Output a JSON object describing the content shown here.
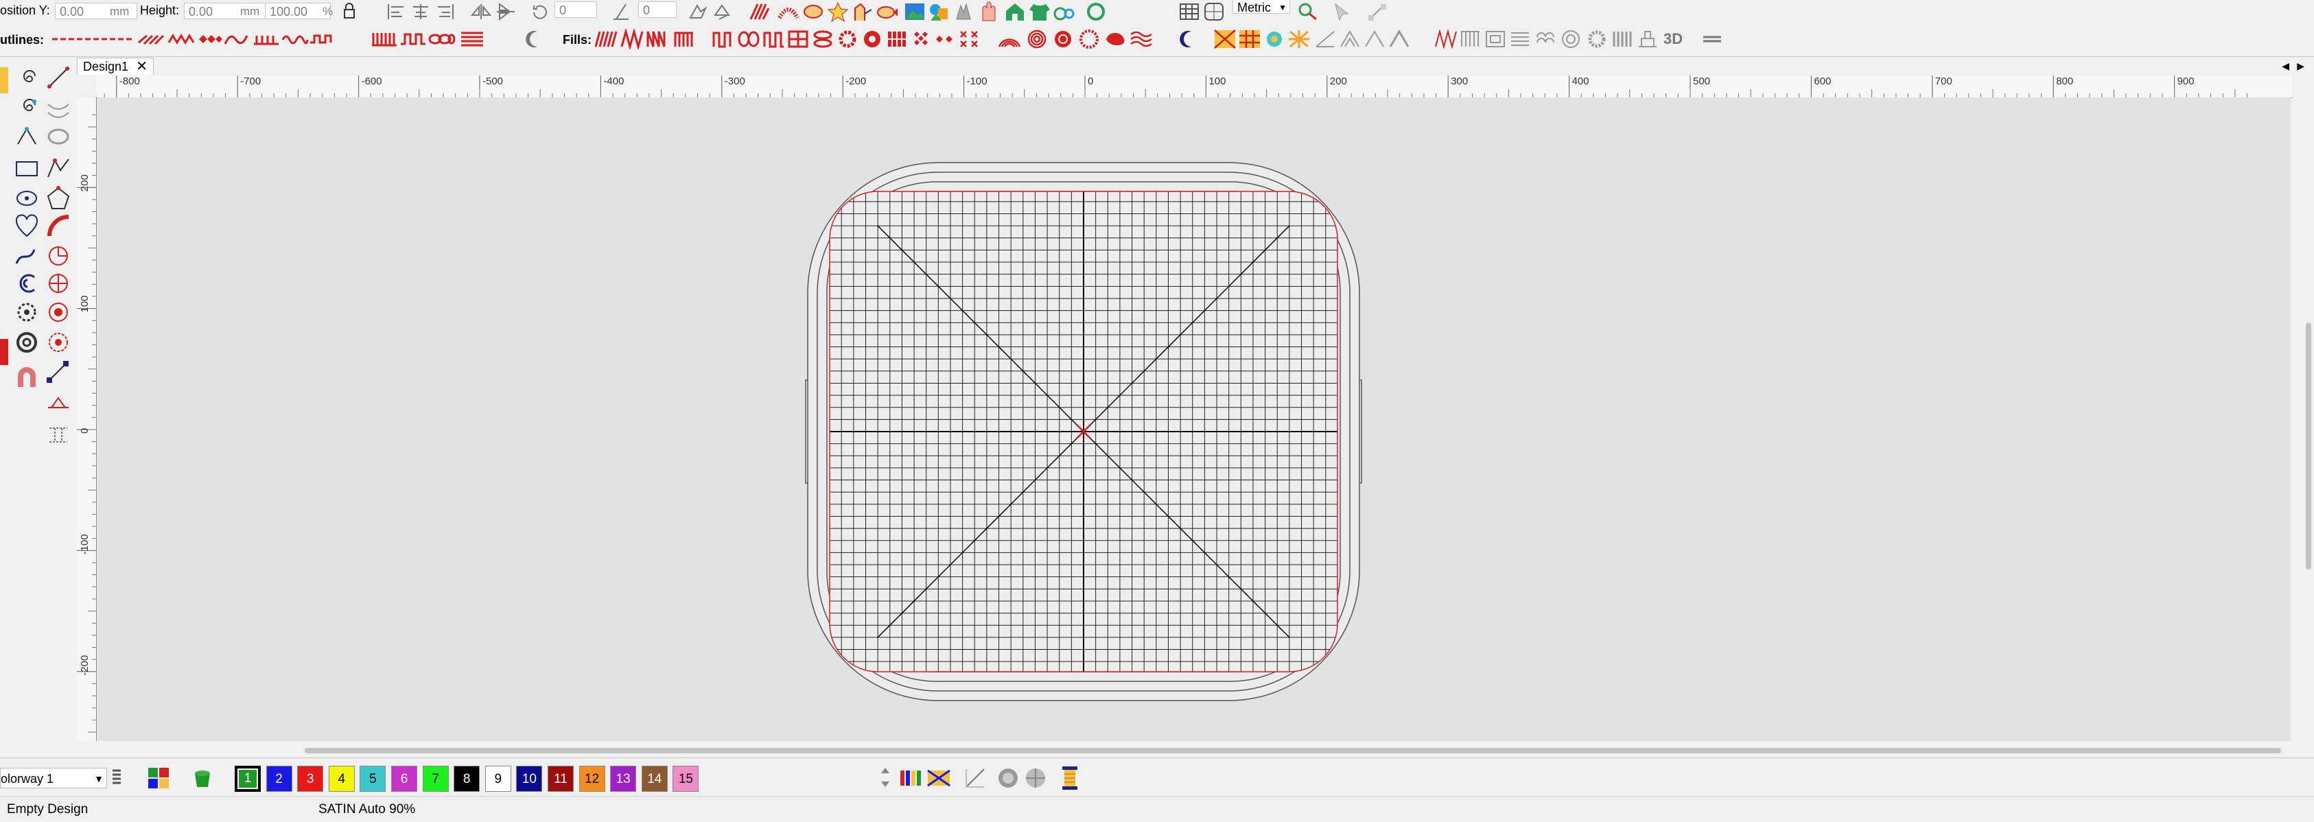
{
  "toolbar": {
    "position_y_label": "osition Y:",
    "position_y_value": "0.00",
    "position_y_unit": "mm",
    "height_label": "Height:",
    "height_value": "0.00",
    "height_unit": "mm",
    "scale_value": "100.00",
    "scale_unit": "%",
    "rotate_value": "0",
    "angle_value": "0",
    "units_select": "Metric",
    "outlines_label": "utlines:",
    "fills_label": "Fills:",
    "view_3d_label": "3D"
  },
  "tab": {
    "title": "Design1",
    "close": "✕"
  },
  "rulers": {
    "horizontal": [
      "-800",
      "-700",
      "-600",
      "-500",
      "-400",
      "-300",
      "-200",
      "-100",
      "0",
      "100",
      "200",
      "300",
      "400",
      "500",
      "600",
      "700",
      "800",
      "900"
    ],
    "vertical": [
      "200",
      "100",
      "0",
      "-100",
      "-200"
    ]
  },
  "colorway": {
    "label": "olorway 1"
  },
  "palette": [
    {
      "num": "1",
      "color": "#1e9a2a",
      "text_color": "#ffffff",
      "selected": true
    },
    {
      "num": "2",
      "color": "#1a1ae6",
      "text_color": "#ffffff"
    },
    {
      "num": "3",
      "color": "#e61919",
      "text_color": "#ffffff"
    },
    {
      "num": "4",
      "color": "#f5f50a",
      "text_color": "#000000"
    },
    {
      "num": "5",
      "color": "#3cc8c8",
      "text_color": "#000000"
    },
    {
      "num": "6",
      "color": "#c832c8",
      "text_color": "#ffffff"
    },
    {
      "num": "7",
      "color": "#1ef01e",
      "text_color": "#000000"
    },
    {
      "num": "8",
      "color": "#000000",
      "text_color": "#ffffff"
    },
    {
      "num": "9",
      "color": "#ffffff",
      "text_color": "#000000"
    },
    {
      "num": "10",
      "color": "#0a0a8c",
      "text_color": "#ffffff"
    },
    {
      "num": "11",
      "color": "#9b0d0d",
      "text_color": "#ffffff"
    },
    {
      "num": "12",
      "color": "#f58c1e",
      "text_color": "#000000"
    },
    {
      "num": "13",
      "color": "#a020c8",
      "text_color": "#ffffff"
    },
    {
      "num": "14",
      "color": "#8c5a32",
      "text_color": "#ffffff"
    },
    {
      "num": "15",
      "color": "#f08cc8",
      "text_color": "#000000"
    }
  ],
  "status": {
    "left": "Empty Design",
    "stitch_type": "SATIN Auto 90%"
  },
  "colors": {
    "accent_red": "#d42020",
    "hoop_outline": "#555555",
    "grid_line": "#222222"
  }
}
